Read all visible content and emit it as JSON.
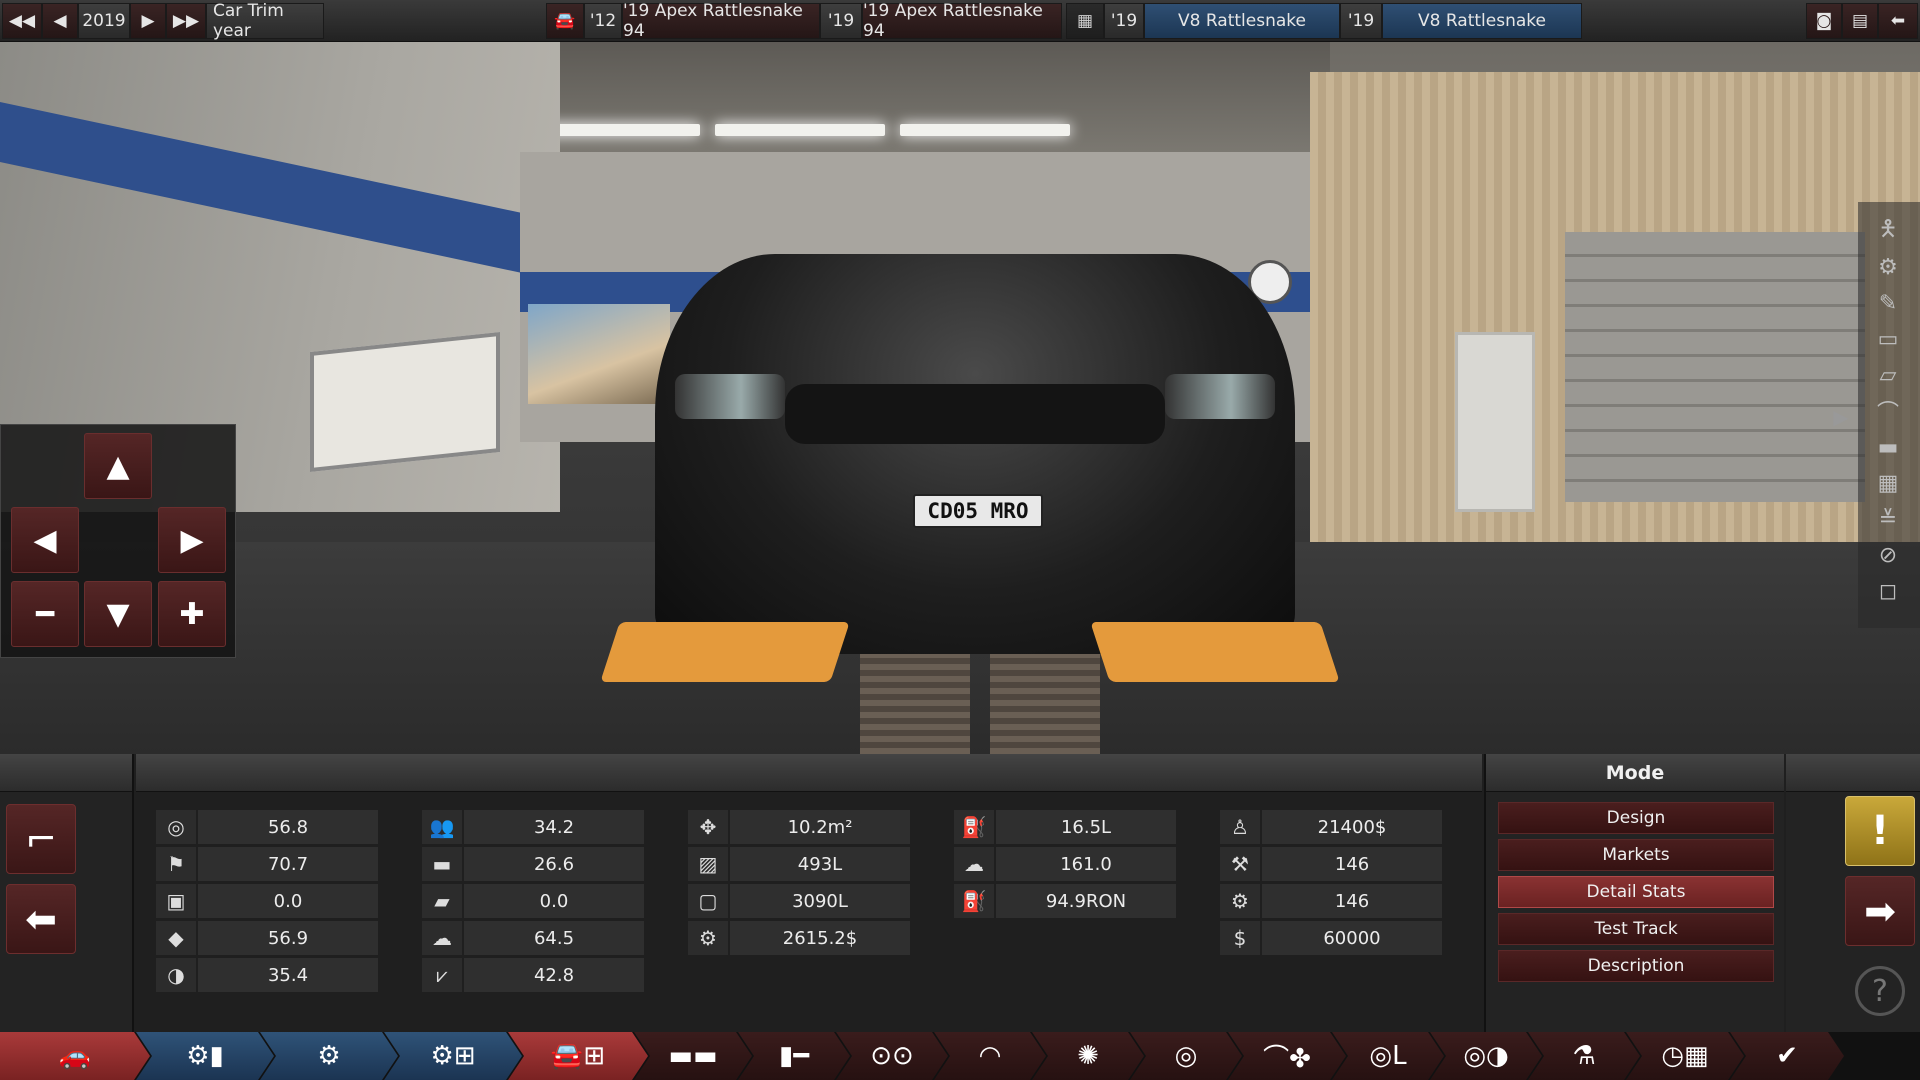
{
  "topbar": {
    "year": "2019",
    "trim_year_label": "Car Trim year",
    "compare_a": {
      "model_year": "'12",
      "trim": "'19 Apex Rattlesnake 94"
    },
    "compare_b": {
      "model_year": "'19",
      "trim": "'19 Apex Rattlesnake 94"
    },
    "engine_a": {
      "year": "'19",
      "name": "V8 Rattlesnake"
    },
    "engine_b": {
      "year": "'19",
      "name": "V8 Rattlesnake"
    }
  },
  "scene": {
    "license_plate": "CD05 MRO"
  },
  "stats": {
    "col1": [
      {
        "icon": "steering-wheel-icon",
        "value": "56.8"
      },
      {
        "icon": "checkered-flag-icon",
        "value": "70.7"
      },
      {
        "icon": "seat-icon",
        "value": "0.0"
      },
      {
        "icon": "diamond-icon",
        "value": "56.9"
      },
      {
        "icon": "safety-icon",
        "value": "35.4"
      }
    ],
    "col2": [
      {
        "icon": "passengers-icon",
        "value": "34.2"
      },
      {
        "icon": "utility-truck-icon",
        "value": "26.6"
      },
      {
        "icon": "offroad-icon",
        "value": "0.0"
      },
      {
        "icon": "environment-icon",
        "value": "64.5"
      },
      {
        "icon": "reliability-icon",
        "value": "42.8"
      }
    ],
    "col3": [
      {
        "icon": "dimensions-icon",
        "value": "10.2m²"
      },
      {
        "icon": "cargo-icon",
        "value": "493L"
      },
      {
        "icon": "passenger-volume-icon",
        "value": "3090L"
      },
      {
        "icon": "cost-gear-icon",
        "value": "2615.2$"
      }
    ],
    "col4": [
      {
        "icon": "fuel-tank-icon",
        "value": "16.5L"
      },
      {
        "icon": "emissions-icon",
        "value": "161.0"
      },
      {
        "icon": "fuel-pump-icon",
        "value": "94.9RON"
      }
    ],
    "col5": [
      {
        "icon": "price-person-icon",
        "value": "21400$"
      },
      {
        "icon": "production-icon",
        "value": "146"
      },
      {
        "icon": "engineering-icon",
        "value": "146"
      },
      {
        "icon": "dollar-icon",
        "value": "60000"
      }
    ]
  },
  "mode": {
    "title": "Mode",
    "buttons": [
      "Design",
      "Markets",
      "Detail Stats",
      "Test Track",
      "Description"
    ],
    "active": "Detail Stats"
  },
  "colors": {
    "accent_red": "#8a3232",
    "done_blue": "#2f5378",
    "warn_gold": "#c9a83a"
  }
}
